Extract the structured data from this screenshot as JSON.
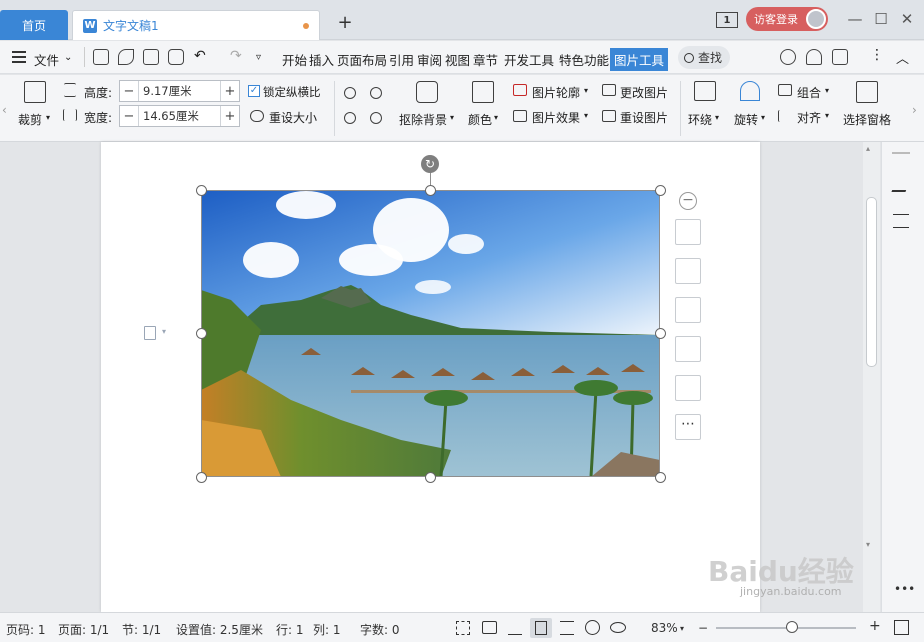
{
  "tabs": {
    "home": "首页",
    "doc": "文字文稿1",
    "new_tab": "+"
  },
  "titlebar": {
    "page_badge": "1",
    "login": "访客登录",
    "minimize": "—",
    "restore": "☐",
    "close": "✕"
  },
  "menu": {
    "file": "文件",
    "items": [
      "开始",
      "插入",
      "页面布局",
      "引用",
      "审阅",
      "视图",
      "章节",
      "开发工具",
      "特色功能",
      "图片工具"
    ],
    "active": "图片工具",
    "search": "查找"
  },
  "ribbon": {
    "crop": "裁剪",
    "height_label": "高度:",
    "height_value": "9.17厘米",
    "width_label": "宽度:",
    "width_value": "14.65厘米",
    "lock_ratio": "锁定纵横比",
    "reset_size": "重设大小",
    "remove_bg": "抠除背景",
    "color": "颜色",
    "outline": "图片轮廓",
    "effect": "图片效果",
    "change_pic": "更改图片",
    "reset_pic": "重设图片",
    "wrap": "环绕",
    "rotate": "旋转",
    "group": "组合",
    "align": "对齐",
    "select_pane": "选择窗格"
  },
  "status": {
    "page_num": "页码: 1",
    "pages": "页面: 1/1",
    "section": "节: 1/1",
    "setting": "设置值: 2.5厘米",
    "row": "行: 1",
    "col": "列: 1",
    "words": "字数: 0",
    "zoom": "83%",
    "zoom_level": 0.83
  },
  "watermark": {
    "line1": "Baidu经验",
    "line2": "jingyan.baidu.com"
  },
  "colors": {
    "accent": "#3a86d6",
    "login": "#d75f5f"
  }
}
